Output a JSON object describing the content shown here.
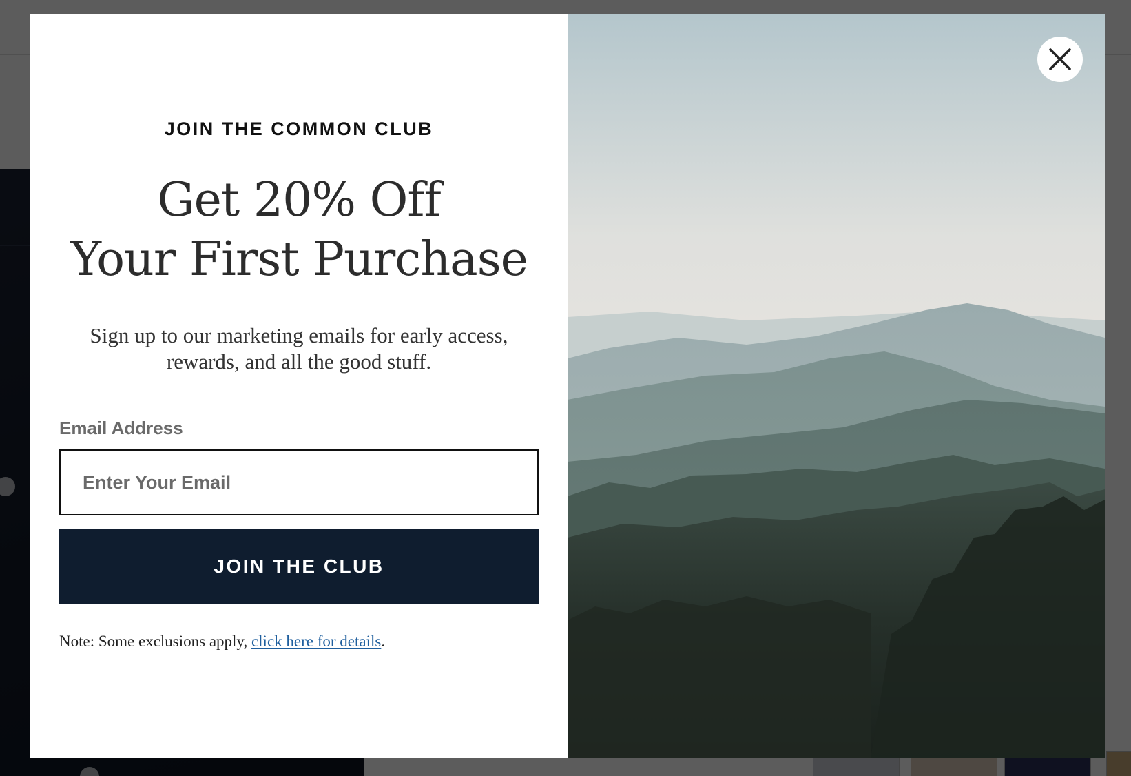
{
  "modal": {
    "eyebrow": "JOIN THE COMMON CLUB",
    "headline_line1": "Get 20% Off",
    "headline_line2": "Your First Purchase",
    "subcopy": "Sign up to our marketing emails for early access, rewards, and all the good stuff.",
    "email_label": "Email Address",
    "email_placeholder": "Enter Your Email",
    "email_value": "",
    "join_button_label": "JOIN THE CLUB",
    "note_prefix": "Note: Some exclusions apply, ",
    "note_link": "click here for details",
    "note_suffix": ".",
    "close_icon": "close-icon",
    "image_subject": "misty forested mountain ridges",
    "colors": {
      "button_bg": "#0f1d2f",
      "link": "#1f5f9e"
    }
  }
}
